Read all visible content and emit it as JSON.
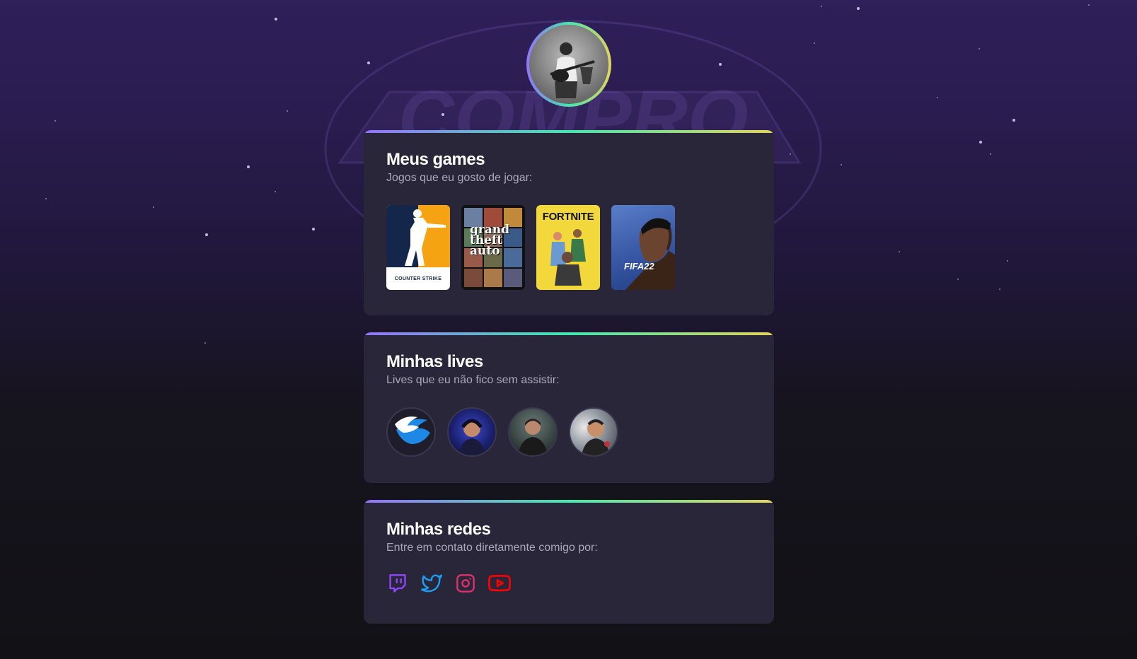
{
  "profile": {
    "avatar_alt": "Foto de perfil"
  },
  "sections": {
    "games": {
      "title": "Meus games",
      "subtitle": "Jogos que eu gosto de jogar:",
      "items": [
        {
          "name": "Counter Strike",
          "label_1": "COUNTER",
          "label_2": "STRIKE"
        },
        {
          "name": "Grand Theft Auto V",
          "label_1": "grand",
          "label_2": "theft",
          "label_3": "auto"
        },
        {
          "name": "Fortnite",
          "label_1": "FORTNITE"
        },
        {
          "name": "FIFA 22",
          "label_1": "FIFA22"
        }
      ]
    },
    "lives": {
      "title": "Minhas lives",
      "subtitle": "Lives que eu não fico sem assistir:"
    },
    "redes": {
      "title": "Minhas redes",
      "subtitle": "Entre em contato diretamente comigo por:",
      "items": [
        {
          "icon": "twitch-icon",
          "color": "#9146ff"
        },
        {
          "icon": "twitter-icon",
          "color": "#1d9bf0"
        },
        {
          "icon": "instagram-icon",
          "color": "#e1306c"
        },
        {
          "icon": "youtube-icon",
          "color": "#ff0000"
        }
      ]
    }
  },
  "colors": {
    "accent_start": "#9572fc",
    "accent_mid": "#43e7ad",
    "accent_end": "#e2d45c",
    "card_bg": "#29263a"
  }
}
